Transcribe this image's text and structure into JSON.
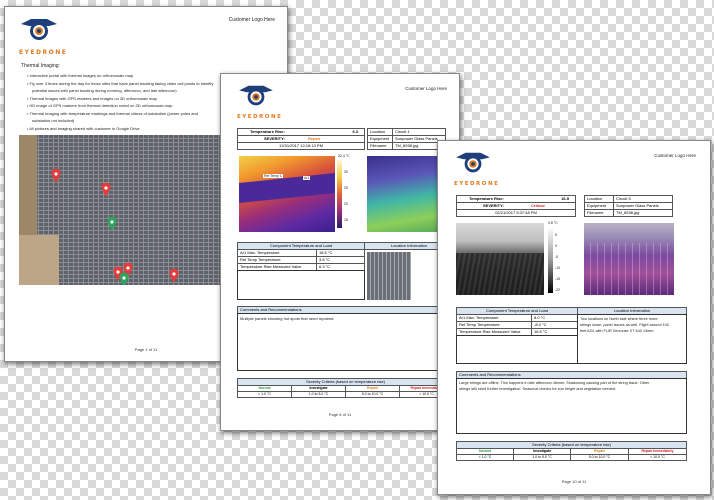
{
  "brand": {
    "name": "EYEDRONE",
    "customer_logo": "Customer Logo Here"
  },
  "page1": {
    "section_title": "Thermal Imaging:",
    "bullets": [
      "Interactive portal with thermal images on orthomosaic map",
      "Fly over 3 times during the day for those sites that have panel tracking taking video cell points to identify",
      "potential issues with panel tracking during morning, afternoon, and late afternoon)",
      "Thermal images with GPS markers and images on 3D orthomosaic map",
      "HD image of GPS markers from thermal detection noted on 3D orthomosaic map",
      "Thermal imaging with temperature markings and thermal videos of substation (power poles and",
      "substation not included)",
      "All pictures and imaging shared with customer in Google Drive"
    ],
    "footer": "Page 1 of 11"
  },
  "page2": {
    "temp_rise_label": "Temperature Rise:",
    "temp_rise_value": "6.3",
    "severity_label": "SEVERITY:",
    "severity_value": "Repair",
    "datetime": "12/31/2017 12:18:13 PM",
    "location_label": "Location",
    "location_value": "Circuit 1",
    "equipment_label": "Equipment",
    "equipment_value": "Sunpower Glass Panels",
    "filename_label": "Filename",
    "filename_value": "TM_8938.jpg",
    "scale_top": "32.4 °C",
    "scale_ticks": [
      "30",
      "25",
      "20",
      "15"
    ],
    "marker1": "Ref Temp 1",
    "marker2": "Ar1",
    "component_header": "Component Temperature and Load",
    "location_header": "Location Information",
    "rows": [
      {
        "label": "Ar1 Max. Temperature",
        "value": "18.5 °C"
      },
      {
        "label": "Ref Temp Temperature",
        "value": "3.6 °C"
      },
      {
        "label": "Temperature Rise Measured Value",
        "value": "6.3 °C"
      }
    ],
    "comments_header": "Comments and Recommendations",
    "comments": "Multiple panels showing hot spots that need repaired.",
    "criteria_title": "Severity Criteria (based on temperature rise)",
    "criteria_labels": [
      "Normal",
      "Investigate",
      "Repair",
      "Repair Immediately"
    ],
    "criteria_values": [
      "< 1.0 °C",
      "1.0 to 5.0 °C",
      "5.0 to 10.0 °C",
      "> 10.0 °C"
    ],
    "footer": "Page 6 of 11"
  },
  "page3": {
    "temp_rise_label": "Temperature Rise:",
    "temp_rise_value": "16.5",
    "severity_label": "SEVERITY:",
    "severity_value": "Critical",
    "datetime": "02/21/2017 5:37:48 PM",
    "location_label": "Location",
    "location_value": "Circuit 5",
    "equipment_label": "Equipment",
    "equipment_value": "Sunpower Glass Panels",
    "filename_label": "Filename",
    "filename_value": "TM_8538.jpg",
    "scale_top": "9.8 °C",
    "scale_ticks": [
      "5",
      "0",
      "-5",
      "-10",
      "-15",
      "-22"
    ],
    "component_header": "Component Temperature and Load",
    "location_header": "Location Information",
    "rows": [
      {
        "label": "Ar1 Max. Temperature",
        "value": "8.0 °C"
      },
      {
        "label": "Ref Temp Temperature",
        "value": "-8.0 °C"
      },
      {
        "label": "Temperature Rise Measured Value",
        "value": "16.5 °C"
      }
    ],
    "location_text": [
      "Two locations on North side where three more",
      "strings down, panel issues as well. Flight around 100",
      "feet AGL with FLIR Zenmuse XT 640 13mm."
    ],
    "comments_header": "Comments and Recommendations",
    "comments": [
      "Large strings are offline. This happens in late afternoon /dinner. Shadowing causing part of the string issue. Other",
      "strings still need further investigation. Seasonal checks for sun height and vegetation needed."
    ],
    "criteria_title": "Severity Criteria (based on temperature rise)",
    "criteria_labels": [
      "Normal",
      "Investigate",
      "Repair",
      "Repair Immediately"
    ],
    "criteria_values": [
      "< 1.0 °C",
      "1.0 to 5.0 °C",
      "5.0 to 10.0 °C",
      "> 10.0 °C"
    ],
    "footer": "Page 10 of 11"
  },
  "colors": {
    "brand_orange": "#e07a1f",
    "normal": "#2e9a3e",
    "investigate": "#222222",
    "repair": "#e07a1f",
    "critical": "#d42020",
    "header_blue": "#d8e4f0"
  }
}
